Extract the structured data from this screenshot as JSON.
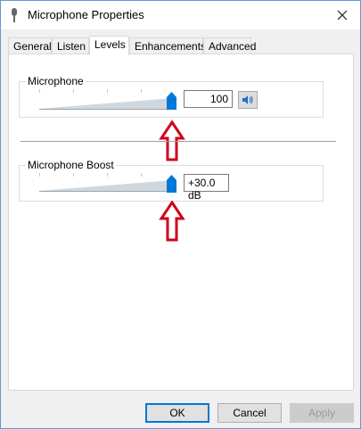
{
  "window": {
    "title": "Microphone Properties"
  },
  "tabs": [
    {
      "label": "General",
      "active": false
    },
    {
      "label": "Listen",
      "active": false
    },
    {
      "label": "Levels",
      "active": true
    },
    {
      "label": "Enhancements",
      "active": false
    },
    {
      "label": "Advanced",
      "active": false
    }
  ],
  "microphone": {
    "label": "Microphone",
    "value": "100",
    "level_fraction": 1.0,
    "speaker_icon": "speaker-icon"
  },
  "boost": {
    "label": "Microphone Boost",
    "value": "+30.0 dB",
    "level_fraction": 1.0
  },
  "buttons": {
    "ok": "OK",
    "cancel": "Cancel",
    "apply": "Apply"
  },
  "colors": {
    "accent": "#0078d7",
    "arrow": "#d0021b",
    "thumb": "#0078d7"
  }
}
